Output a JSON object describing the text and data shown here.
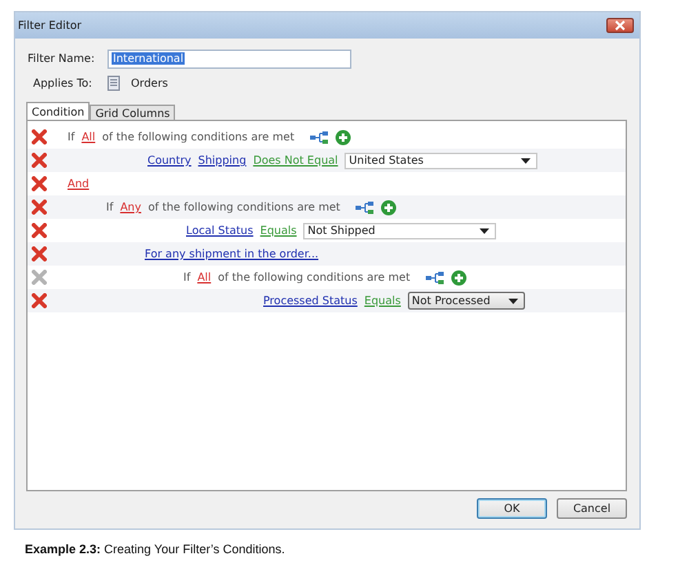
{
  "window": {
    "title": "Filter Editor"
  },
  "filter_name": {
    "label": "Filter Name:",
    "value": "International"
  },
  "applies_to": {
    "label": "Applies To:",
    "value": "Orders"
  },
  "tabs": [
    {
      "label": "Condition",
      "selected": true
    },
    {
      "label": "Grid Columns",
      "selected": false
    }
  ],
  "conditions": [
    {
      "kind": "group",
      "disabled": false,
      "prefix": "If",
      "quantifier": "All",
      "suffix": "of the following conditions are met",
      "children": [
        {
          "kind": "condition",
          "disabled": false,
          "fields": [
            "Country",
            "Shipping"
          ],
          "operator": "Does Not Equal",
          "value": "United States",
          "raised": false
        }
      ]
    },
    {
      "kind": "link",
      "disabled": false,
      "text": "And",
      "children": [
        {
          "kind": "group",
          "disabled": false,
          "prefix": "If",
          "quantifier": "Any",
          "suffix": "of the following conditions are met",
          "children": [
            {
              "kind": "condition",
              "disabled": false,
              "fields": [
                "Local Status"
              ],
              "operator": "Equals",
              "value": "Not Shipped",
              "raised": false
            },
            {
              "kind": "scope",
              "disabled": false,
              "text": "For any shipment in the order...",
              "children": [
                {
                  "kind": "group",
                  "disabled": true,
                  "prefix": "If",
                  "quantifier": "All",
                  "suffix": "of the following conditions are met",
                  "children": [
                    {
                      "kind": "condition",
                      "disabled": false,
                      "fields": [
                        "Processed Status"
                      ],
                      "operator": "Equals",
                      "value": "Not Processed",
                      "raised": true
                    }
                  ]
                }
              ]
            }
          ]
        }
      ]
    }
  ],
  "buttons": [
    {
      "label": "OK",
      "default": true
    },
    {
      "label": "Cancel",
      "default": false
    }
  ],
  "caption": "**Example 2.3:** Creating Your Filter’s Conditions."
}
